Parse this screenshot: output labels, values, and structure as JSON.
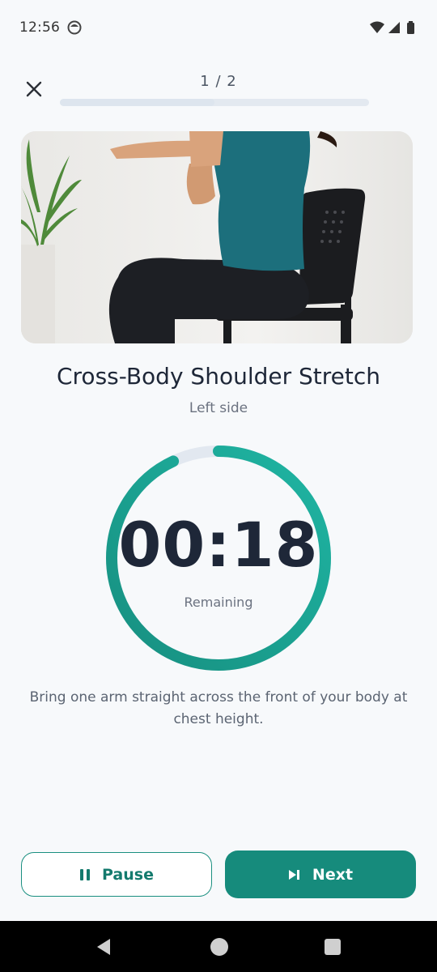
{
  "status_bar": {
    "time": "12:56",
    "app_icon": "notification-face-icon",
    "icons": [
      "wifi-icon",
      "cell-signal-icon",
      "battery-icon"
    ]
  },
  "header": {
    "close_icon": "close-icon",
    "step_counter": "1 / 2",
    "progress_fraction": 0.5
  },
  "exercise": {
    "image_alt": "woman-seated-on-chair-stretching-arm",
    "title": "Cross-Body Shoulder Stretch",
    "side": "Left side",
    "timer_value": "00:18",
    "timer_label": "Remaining",
    "timer_remaining_fraction": 0.93,
    "instruction": "Bring one arm straight across the front of your body at chest height."
  },
  "actions": {
    "pause_label": "Pause",
    "pause_icon": "pause-icon",
    "next_label": "Next",
    "next_icon": "skip-next-icon"
  },
  "colors": {
    "accent": "#168b7c",
    "accent_light": "#1fb5a3",
    "track": "#e2e8f0",
    "text_dark": "#1e2738",
    "text_muted": "#6b7280"
  },
  "system_nav": [
    "back-icon",
    "home-icon",
    "recents-icon"
  ]
}
